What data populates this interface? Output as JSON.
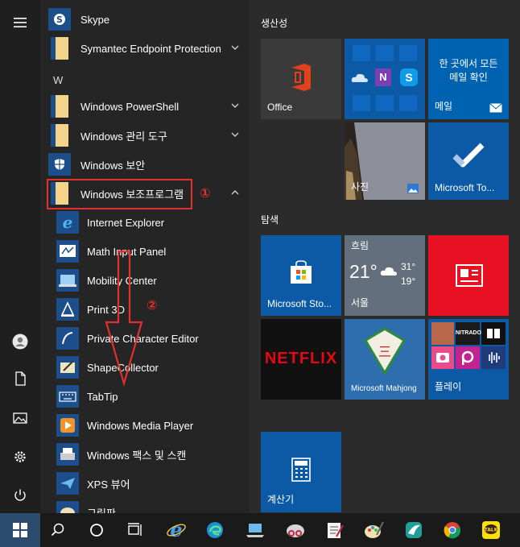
{
  "apps": {
    "skype": "Skype",
    "symantec": "Symantec Endpoint Protection",
    "letter_w": "W",
    "powershell": "Windows PowerShell",
    "admin_tools": "Windows 관리 도구",
    "security": "Windows 보안",
    "accessories": "Windows 보조프로그램",
    "ie": "Internet Explorer",
    "math": "Math Input Panel",
    "mobility": "Mobility Center",
    "print3d": "Print 3D",
    "private_char": "Private Character Editor",
    "shape": "ShapeCollector",
    "tabtip": "TabTip",
    "wmp": "Windows Media Player",
    "fax": "Windows 팩스 및 스캔",
    "xps": "XPS 뷰어",
    "paint": "그림판"
  },
  "annotations": {
    "one": "①",
    "two": "②"
  },
  "groups": {
    "productivity": "생산성",
    "explore": "탐색"
  },
  "tiles": {
    "office": "Office",
    "mail_text1": "한 곳에서 모든",
    "mail_text2": "메일 확인",
    "mail": "메일",
    "photos": "사진",
    "todo": "Microsoft To...",
    "store": "Microsoft Sto...",
    "weather_cond": "흐림",
    "weather_temp": "21°",
    "weather_hi": "31°",
    "weather_lo": "19°",
    "weather_city": "서울",
    "netflix": "NETFLIX",
    "mahjong": "Microsoft Mahjong",
    "play": "플레이",
    "nitrado": "NITRADO",
    "calc": "계산기"
  },
  "colors": {
    "accent": "#0063b1",
    "annotation_red": "#e0312f",
    "netflix_red": "#e50914",
    "news_red": "#e81123",
    "office_dark": "#3a3a3a",
    "tile_blue": "#0c5aa6"
  }
}
